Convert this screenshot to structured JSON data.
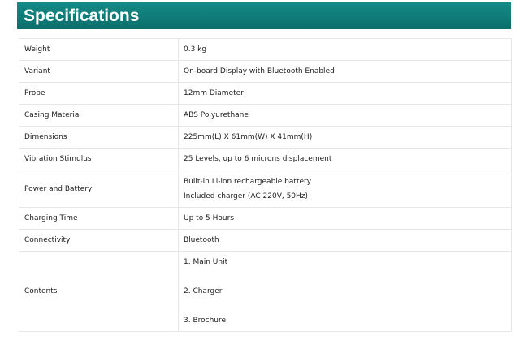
{
  "header": {
    "title": "Specifications"
  },
  "specs": [
    {
      "label": "Weight",
      "value": "0.3 kg"
    },
    {
      "label": "Variant",
      "value": "On-board Display with Bluetooth Enabled"
    },
    {
      "label": "Probe",
      "value": "12mm Diameter"
    },
    {
      "label": "Casing Material",
      "value": "ABS Polyurethane"
    },
    {
      "label": "Dimensions",
      "value": "225mm(L) X 61mm(W) X 41mm(H)"
    },
    {
      "label": "Vibration Stimulus",
      "value": "25 Levels, up to 6 microns displacement"
    },
    {
      "label": "Power and Battery",
      "lines": [
        "Built-in Li-ion rechargeable battery",
        "Included charger (AC 220V, 50Hz)"
      ]
    },
    {
      "label": "Charging Time",
      "value": "Up to 5 Hours"
    },
    {
      "label": "Connectivity",
      "value": "Bluetooth"
    },
    {
      "label": "Contents",
      "lines": [
        "1. Main Unit",
        "2. Charger",
        "3. Brochure"
      ]
    }
  ],
  "colors": {
    "header_bg": "#0f7c78",
    "header_text": "#ffffff",
    "border": "#e6e6e6"
  }
}
